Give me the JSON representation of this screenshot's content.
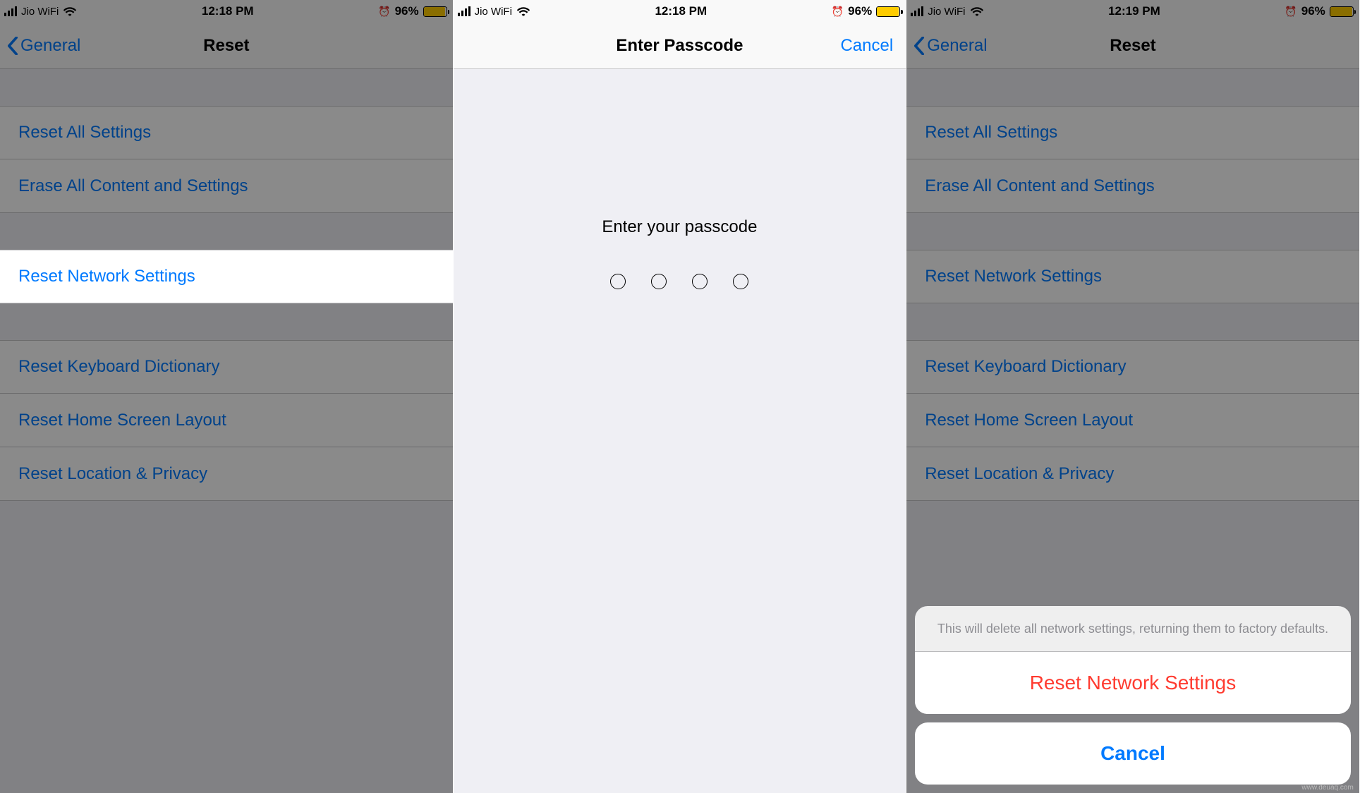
{
  "status": {
    "carrier": "Jio WiFi",
    "time_a": "12:18 PM",
    "time_b": "12:18 PM",
    "time_c": "12:19 PM",
    "battery_pct": "96%",
    "battery_fill": "96%"
  },
  "screen1": {
    "back_label": "General",
    "title": "Reset",
    "rows": {
      "reset_all": "Reset All Settings",
      "erase_all": "Erase All Content and Settings",
      "reset_network": "Reset Network Settings",
      "reset_keyboard": "Reset Keyboard Dictionary",
      "reset_home": "Reset Home Screen Layout",
      "reset_location": "Reset Location & Privacy"
    }
  },
  "screen2": {
    "title": "Enter Passcode",
    "cancel": "Cancel",
    "prompt": "Enter your passcode"
  },
  "screen3": {
    "back_label": "General",
    "title": "Reset",
    "sheet": {
      "message": "This will delete all network settings, returning them to factory defaults.",
      "action": "Reset Network Settings",
      "cancel": "Cancel"
    }
  },
  "watermark": "www.deuaq.com"
}
